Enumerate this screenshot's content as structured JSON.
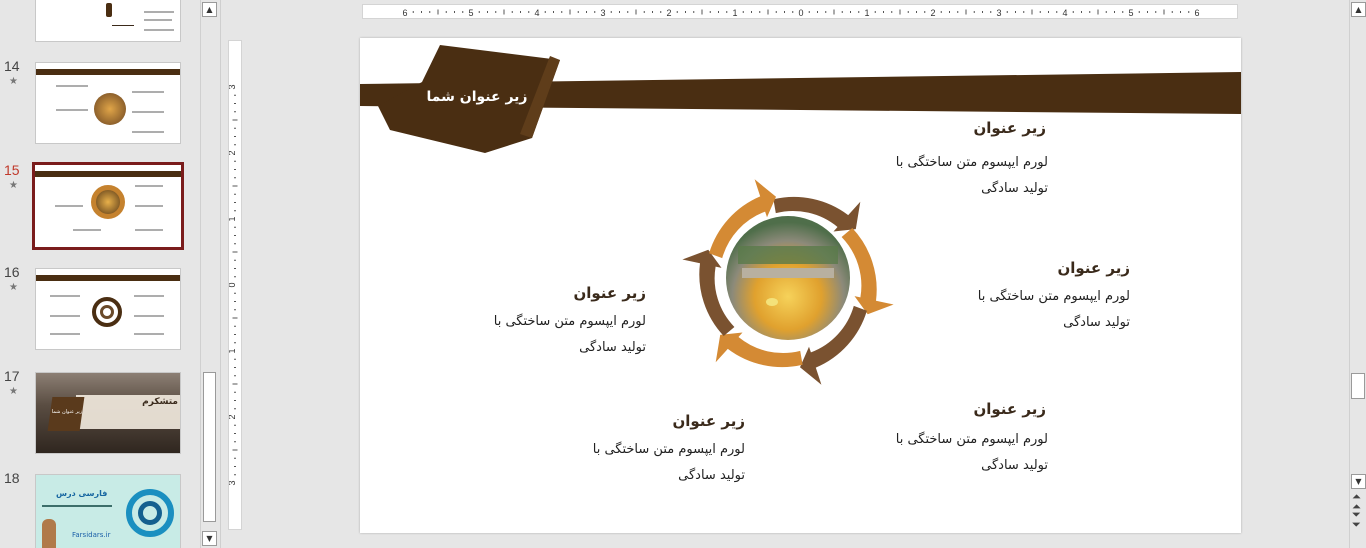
{
  "thumbnails": [
    {
      "number": "14",
      "starred": true
    },
    {
      "number": "15",
      "starred": true,
      "selected": true
    },
    {
      "number": "16",
      "starred": true
    },
    {
      "number": "17",
      "starred": true
    },
    {
      "number": "18",
      "starred": false
    }
  ],
  "thumb17": {
    "title": "متشکرم",
    "subtitle": "زیر عنوان شما"
  },
  "thumb18": {
    "brand": "فارسی درس",
    "url": "Farsidars.ir"
  },
  "ruler": {
    "h_labels": [
      "6",
      "5",
      "4",
      "3",
      "2",
      "1",
      "0",
      "1",
      "2",
      "3",
      "4",
      "5",
      "6"
    ],
    "v_labels": [
      "3",
      "2",
      "1",
      "0",
      "1",
      "2",
      "3"
    ]
  },
  "slide": {
    "banner_title": "زیر عنوان شما",
    "items": [
      {
        "heading": "زیر عنوان",
        "line1": "لورم ایپسوم متن ساختگی با",
        "line2": "تولید سادگی"
      },
      {
        "heading": "زیر عنوان",
        "line1": "لورم ایپسوم متن ساختگی با",
        "line2": "تولید سادگی"
      },
      {
        "heading": "زیر عنوان",
        "line1": "لورم ایپسوم متن ساختگی با",
        "line2": "تولید سادگی"
      },
      {
        "heading": "زیر عنوان",
        "line1": "لورم ایپسوم متن ساختگی با",
        "line2": "تولید سادگی"
      },
      {
        "heading": "زیر عنوان",
        "line1": "لورم ایپسوم متن ساختگی با",
        "line2": "تولید سادگی"
      }
    ]
  },
  "colors": {
    "brown_dark": "#4a2e12",
    "brown_mid": "#7a5230",
    "orange": "#d48a34",
    "accent_selected": "#7a1c1c"
  },
  "icons": {
    "scroll_up": "triangle-up",
    "scroll_down": "triangle-down",
    "prev_slide": "double-up",
    "next_slide": "double-down"
  }
}
